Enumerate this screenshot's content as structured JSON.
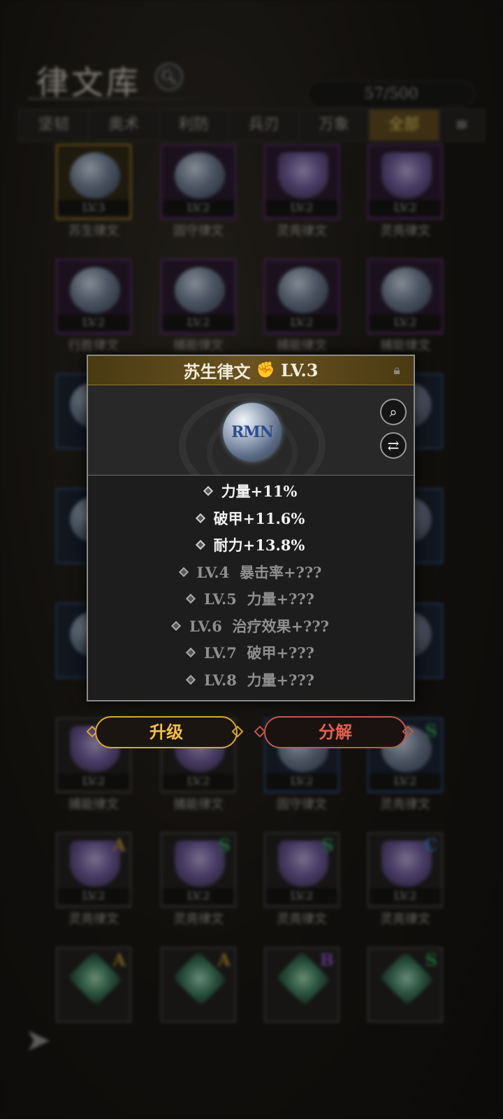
{
  "header": {
    "title": "律文库",
    "capacity": "57/500"
  },
  "tabs": [
    "坚韧",
    "奥术",
    "利防",
    "兵刃",
    "万象",
    "全部"
  ],
  "tiles": [
    {
      "name": "苏生律文",
      "lv": "LV.3",
      "rank": ""
    },
    {
      "name": "固守律文",
      "lv": "LV.2",
      "rank": ""
    },
    {
      "name": "灵亮律文",
      "lv": "LV.2",
      "rank": ""
    },
    {
      "name": "灵亮律文",
      "lv": "LV.2",
      "rank": ""
    },
    {
      "name": "行胜律文",
      "lv": "LV.2",
      "rank": ""
    },
    {
      "name": "捕能律文",
      "lv": "LV.2",
      "rank": ""
    },
    {
      "name": "捕能律文",
      "lv": "LV.2",
      "rank": ""
    },
    {
      "name": "捕能律文",
      "lv": "LV.2",
      "rank": ""
    },
    {
      "name": "捕能律文",
      "lv": "LV.2",
      "rank": ""
    },
    {
      "name": "捕能律文",
      "lv": "LV.2",
      "rank": ""
    },
    {
      "name": "固守律文",
      "lv": "LV.2",
      "rank": ""
    },
    {
      "name": "灵亮律文",
      "lv": "LV.2",
      "rank": "S"
    },
    {
      "name": "灵亮律文",
      "lv": "LV.2",
      "rank": "A"
    },
    {
      "name": "灵亮律文",
      "lv": "LV.2",
      "rank": "S"
    },
    {
      "name": "灵亮律文",
      "lv": "LV.2",
      "rank": "S"
    },
    {
      "name": "灵亮律文",
      "lv": "LV.2",
      "rank": "C"
    },
    {
      "name": "",
      "lv": "",
      "rank": "A"
    },
    {
      "name": "",
      "lv": "",
      "rank": "A"
    },
    {
      "name": "",
      "lv": "",
      "rank": "B"
    },
    {
      "name": "",
      "lv": "",
      "rank": "S"
    }
  ],
  "popup": {
    "title": "苏生律文",
    "level": "LV.3",
    "gem_text": "RMN",
    "stats": [
      {
        "text": "力量+11%",
        "unlocked": true
      },
      {
        "text": "破甲+11.6%",
        "unlocked": true
      },
      {
        "text": "耐力+13.8%",
        "unlocked": true
      },
      {
        "text": "LV.4  暴击率+???",
        "unlocked": false
      },
      {
        "text": "LV.5  力量+???",
        "unlocked": false
      },
      {
        "text": "LV.6  治疗效果+???",
        "unlocked": false
      },
      {
        "text": "LV.7  破甲+???",
        "unlocked": false
      },
      {
        "text": "LV.8  力量+???",
        "unlocked": false
      }
    ]
  },
  "actions": {
    "upgrade": "升级",
    "disassemble": "分解"
  },
  "colors": {
    "gold": "#d9a63a",
    "red": "#c0584a",
    "purple": "#5a2b6a",
    "blue": "#2e4a7a"
  }
}
